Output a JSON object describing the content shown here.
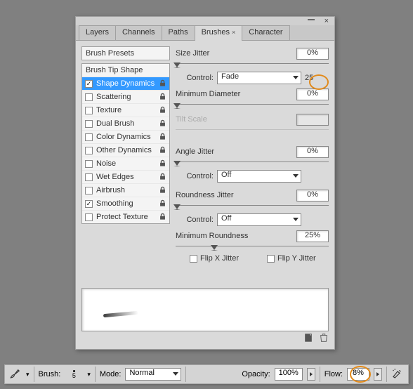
{
  "tabs": {
    "layers": "Layers",
    "channels": "Channels",
    "paths": "Paths",
    "brushes": "Brushes",
    "character": "Character"
  },
  "presets_header": "Brush Presets",
  "preset_items": {
    "tip": "Brush Tip Shape",
    "shape": "Shape Dynamics",
    "scatter": "Scattering",
    "texture": "Texture",
    "dual": "Dual Brush",
    "colord": "Color Dynamics",
    "otherd": "Other Dynamics",
    "noise": "Noise",
    "wet": "Wet Edges",
    "air": "Airbrush",
    "smooth": "Smoothing",
    "protect": "Protect Texture"
  },
  "settings": {
    "size_jitter": {
      "label": "Size Jitter",
      "value": "0%"
    },
    "control_label": "Control:",
    "control1": {
      "value": "Fade",
      "steps": "25"
    },
    "min_diam": {
      "label": "Minimum Diameter",
      "value": "0%"
    },
    "tilt": {
      "label": "Tilt Scale",
      "value": ""
    },
    "angle_jitter": {
      "label": "Angle Jitter",
      "value": "0%"
    },
    "control2": {
      "value": "Off",
      "steps": ""
    },
    "round_jitter": {
      "label": "Roundness Jitter",
      "value": "0%"
    },
    "control3": {
      "value": "Off",
      "steps": ""
    },
    "min_round": {
      "label": "Minimum Roundness",
      "value": "25%"
    },
    "flipx": "Flip X Jitter",
    "flipy": "Flip Y Jitter"
  },
  "options": {
    "brush_label": "Brush:",
    "brush_size": "5",
    "mode_label": "Mode:",
    "mode_value": "Normal",
    "opacity_label": "Opacity:",
    "opacity_value": "100%",
    "flow_label": "Flow:",
    "flow_value": "8%"
  }
}
